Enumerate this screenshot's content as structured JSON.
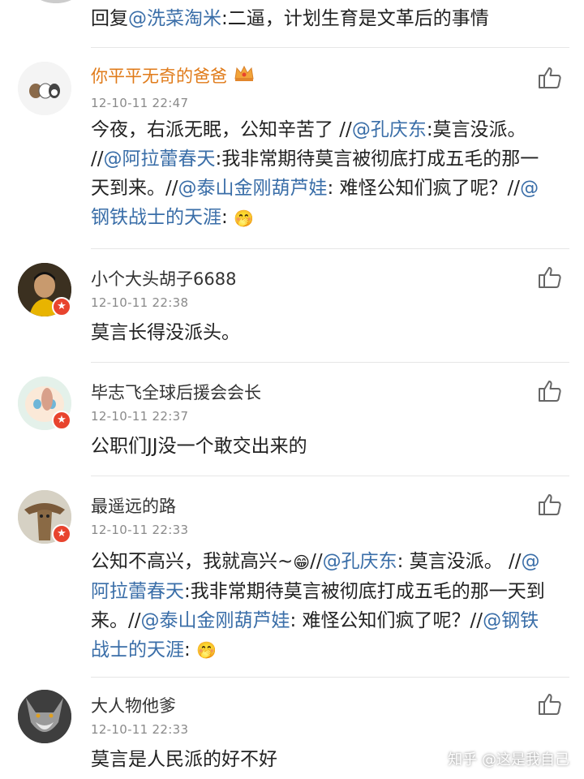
{
  "top_reply": {
    "prefix": "回复",
    "mention": "@洗菜淘米",
    "text": ":二逼，计划生育是文革后的事情"
  },
  "comments": [
    {
      "username": "你平平无奇的爸爸",
      "time": "12-10-11 22:47",
      "segments": [
        {
          "t": "今夜，右派无眠，公知辛苦了 //",
          "m": false
        },
        {
          "t": "@孔庆东",
          "m": true
        },
        {
          "t": ":莫言没派。 //",
          "m": false
        },
        {
          "t": "@阿拉蕾春天",
          "m": true
        },
        {
          "t": ":我非常期待莫言被彻底打成五毛的那一天到来。//",
          "m": false
        },
        {
          "t": "@泰山金刚葫芦娃",
          "m": true
        },
        {
          "t": ": 难怪公知们疯了呢？//",
          "m": false
        },
        {
          "t": "@钢铁战士的天涯",
          "m": true
        },
        {
          "t": ": ",
          "m": false
        }
      ],
      "emoji": "🤭"
    },
    {
      "username": "小个大头胡子6688",
      "time": "12-10-11 22:38",
      "segments": [
        {
          "t": "莫言长得没派头。",
          "m": false
        }
      ]
    },
    {
      "username": "毕志飞全球后援会会长",
      "time": "12-10-11 22:37",
      "segments": [
        {
          "t": "公职们JJ没一个敢交出来的",
          "m": false
        }
      ]
    },
    {
      "username": "最遥远的路",
      "time": "12-10-11 22:33",
      "segments": [
        {
          "t": "公知不高兴，我就高兴~",
          "m": false
        },
        {
          "t": "😁",
          "m": false
        },
        {
          "t": "//",
          "m": false
        },
        {
          "t": "@孔庆东",
          "m": true
        },
        {
          "t": ": 莫言没派。 //",
          "m": false
        },
        {
          "t": "@阿拉蕾春天",
          "m": true
        },
        {
          "t": ":我非常期待莫言被彻底打成五毛的那一天到来。//",
          "m": false
        },
        {
          "t": "@泰山金刚葫芦娃",
          "m": true
        },
        {
          "t": ": 难怪公知们疯了呢？//",
          "m": false
        },
        {
          "t": "@钢铁战士的天涯",
          "m": true
        },
        {
          "t": ": ",
          "m": false
        }
      ],
      "emoji": "🤭"
    },
    {
      "username": "大人物他爹",
      "time": "12-10-11 22:33",
      "segments": [
        {
          "t": "莫言是人民派的好不好",
          "m": false
        }
      ]
    }
  ],
  "watermark": "知乎 @这是我自己",
  "colors": {
    "mention": "#3a6ea8",
    "vip_name": "#e07b1a",
    "badge": "#e8442e",
    "time": "#8a8a8a"
  },
  "icons": {
    "like": "thumbs-up-icon",
    "badge": "verified-badge-icon",
    "crown": "vip-crown-icon"
  }
}
